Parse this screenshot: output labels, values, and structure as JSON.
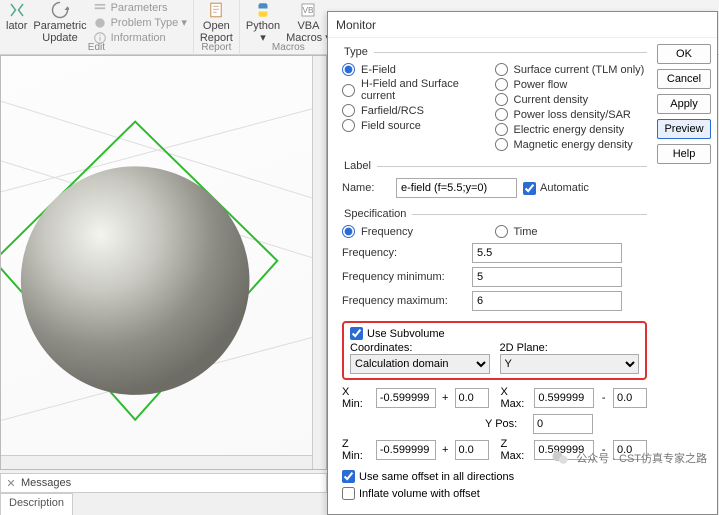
{
  "ribbon": {
    "groups": [
      {
        "label": "Edit",
        "items": [
          {
            "name": "lator",
            "label": "lator"
          },
          {
            "name": "param-update",
            "label": "Parametric\nUpdate"
          },
          {
            "name": "parameters",
            "label": "Parameters",
            "disabled": true
          },
          {
            "name": "problem-type",
            "label": "Problem Type ▾",
            "disabled": true
          },
          {
            "name": "information",
            "label": "Information",
            "disabled": true
          }
        ]
      },
      {
        "label": "Report",
        "items": [
          {
            "name": "open-report",
            "label": "Open\nReport"
          }
        ]
      },
      {
        "label": "Macros",
        "items": [
          {
            "name": "python",
            "label": "Python\n▾"
          },
          {
            "name": "vba",
            "label": "VBA\nMacros ▾"
          }
        ]
      }
    ]
  },
  "messages_tab": "Messages",
  "description_tab": "Description",
  "dialog": {
    "title": "Monitor",
    "buttons": {
      "ok": "OK",
      "cancel": "Cancel",
      "apply": "Apply",
      "preview": "Preview",
      "help": "Help"
    },
    "type": {
      "legend": "Type",
      "left": [
        {
          "id": "efield",
          "label": "E-Field",
          "sel": true
        },
        {
          "id": "hfield",
          "label": "H-Field and Surface current"
        },
        {
          "id": "farfield",
          "label": "Farfield/RCS"
        },
        {
          "id": "fieldsrc",
          "label": "Field source"
        }
      ],
      "right": [
        {
          "id": "tlm",
          "label": "Surface current (TLM only)"
        },
        {
          "id": "pflow",
          "label": "Power flow"
        },
        {
          "id": "cdens",
          "label": "Current density"
        },
        {
          "id": "ploss",
          "label": "Power loss density/SAR"
        },
        {
          "id": "eeng",
          "label": "Electric energy density"
        },
        {
          "id": "meng",
          "label": "Magnetic energy density"
        }
      ]
    },
    "label": {
      "legend": "Label",
      "name_label": "Name:",
      "name_value": "e-field (f=5.5;y=0)",
      "auto_label": "Automatic",
      "auto_checked": true
    },
    "spec": {
      "legend": "Specification",
      "mode": {
        "freq": "Frequency",
        "time": "Time",
        "sel": "freq"
      },
      "rows": [
        {
          "k": "Frequency:",
          "v": "5.5"
        },
        {
          "k": "Frequency minimum:",
          "v": "5"
        },
        {
          "k": "Frequency maximum:",
          "v": "6"
        }
      ]
    },
    "subvol": {
      "use_label": "Use Subvolume",
      "use_checked": true,
      "coords_label": "Coordinates:",
      "coords_value": "Calculation domain",
      "plane_label": "2D Plane:",
      "plane_value": "Y",
      "rows": [
        {
          "minL": "X Min:",
          "minV": "-0.599999",
          "off1": "0.0",
          "maxL": "X Max:",
          "maxV": "0.599999",
          "off2": "0.0"
        },
        {
          "minL": "",
          "minV": "",
          "off1": "",
          "maxL": "Y Pos:",
          "maxV": "0",
          "off2": ""
        },
        {
          "minL": "Z Min:",
          "minV": "-0.599999",
          "off1": "0.0",
          "maxL": "Z Max:",
          "maxV": "0.599999",
          "off2": "0.0"
        }
      ],
      "same_offset": "Use same offset in all directions",
      "same_checked": true,
      "inflate": "Inflate volume with offset",
      "inflate_checked": false
    }
  },
  "watermark": "公众号 · CST仿真专家之路"
}
